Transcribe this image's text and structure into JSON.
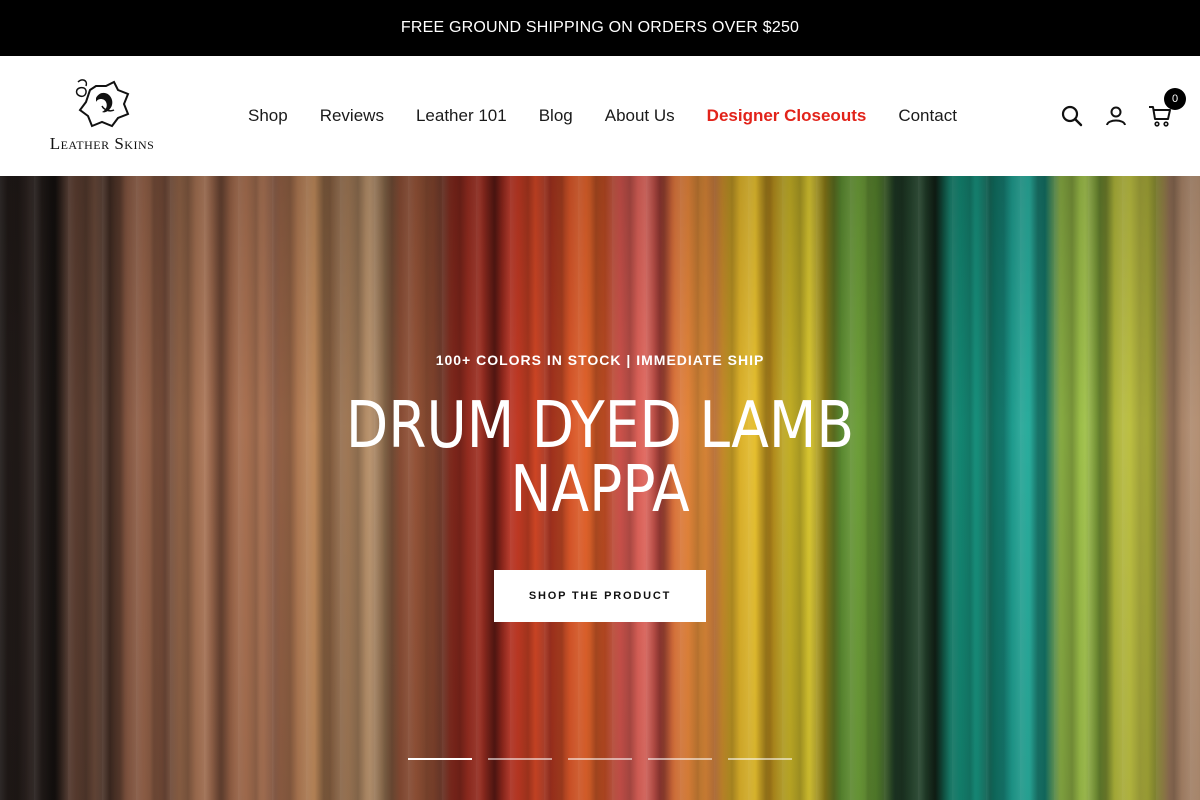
{
  "announcement": {
    "text": "FREE GROUND SHIPPING ON ORDERS OVER $250"
  },
  "logo": {
    "text": "Leather Skins"
  },
  "nav": {
    "items": [
      {
        "label": "Shop"
      },
      {
        "label": "Reviews"
      },
      {
        "label": "Leather 101"
      },
      {
        "label": "Blog"
      },
      {
        "label": "About Us"
      },
      {
        "label": "Designer Closeouts",
        "highlight": true,
        "color": "#e2231a"
      },
      {
        "label": "Contact"
      }
    ]
  },
  "header_icons": {
    "search": "search-icon",
    "account": "account-icon",
    "cart": "cart-icon",
    "cart_count": "0"
  },
  "hero": {
    "eyebrow": "100+ COLORS IN STOCK | IMMEDIATE SHIP",
    "title": "DRUM DYED LAMB NAPPA",
    "button_label": "SHOP THE PRODUCT",
    "slides_total": 5,
    "active_slide": 1
  }
}
